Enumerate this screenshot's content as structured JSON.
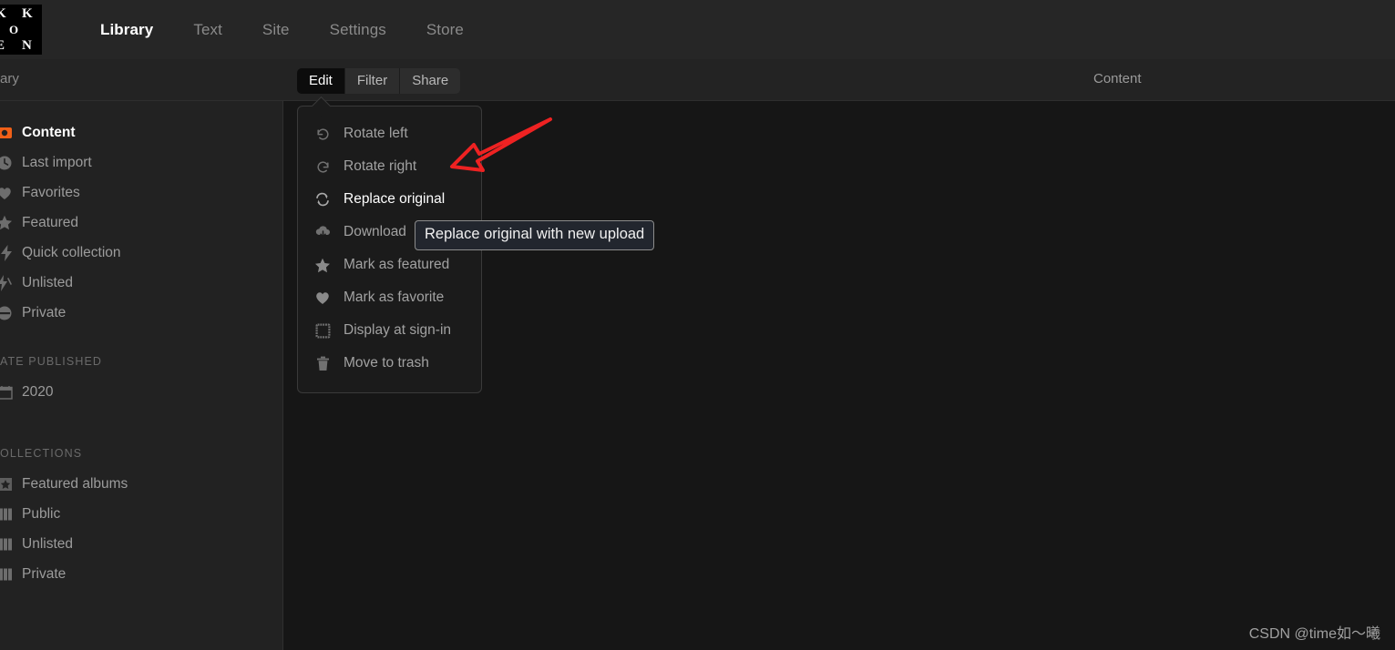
{
  "app": {
    "logo": {
      "letters": [
        "K",
        "K",
        "O",
        "E",
        "N"
      ],
      "name": "koken-logo"
    },
    "nav": [
      {
        "label": "Library",
        "active": true
      },
      {
        "label": "Text",
        "active": false
      },
      {
        "label": "Site",
        "active": false
      },
      {
        "label": "Settings",
        "active": false
      },
      {
        "label": "Store",
        "active": false
      }
    ]
  },
  "subheader": {
    "breadcrumb": "ary",
    "content_title": "Content"
  },
  "sidebar": {
    "items": [
      {
        "label": "Content",
        "icon": "content-icon",
        "active": true
      },
      {
        "label": "Last import",
        "icon": "clock-icon",
        "active": false
      },
      {
        "label": "Favorites",
        "icon": "heart-icon",
        "active": false
      },
      {
        "label": "Featured",
        "icon": "star-icon",
        "active": false
      },
      {
        "label": "Quick collection",
        "icon": "bolt-icon",
        "active": false
      },
      {
        "label": "Unlisted",
        "icon": "unlisted-icon",
        "active": false
      },
      {
        "label": "Private",
        "icon": "private-icon",
        "active": false
      }
    ],
    "date_published_header": "ATE PUBLISHED",
    "date_items": [
      {
        "label": "2020",
        "icon": "calendar-icon"
      }
    ],
    "collections_header": "OLLECTIONS",
    "collection_items": [
      {
        "label": "Featured albums",
        "icon": "featured-albums-icon"
      },
      {
        "label": "Public",
        "icon": "albums-icon"
      },
      {
        "label": "Unlisted",
        "icon": "albums-icon"
      },
      {
        "label": "Private",
        "icon": "albums-icon"
      }
    ]
  },
  "toolbar": {
    "buttons": [
      {
        "label": "Edit",
        "active": true
      },
      {
        "label": "Filter",
        "active": false
      },
      {
        "label": "Share",
        "active": false
      }
    ]
  },
  "edit_menu": {
    "items": [
      {
        "label": "Rotate left",
        "icon": "rotate-left-icon",
        "highlighted": false
      },
      {
        "label": "Rotate right",
        "icon": "rotate-right-icon",
        "highlighted": false
      },
      {
        "label": "Replace original",
        "icon": "replace-icon",
        "highlighted": true
      },
      {
        "label": "Download",
        "icon": "download-icon",
        "highlighted": false
      },
      {
        "label": "Mark as featured",
        "icon": "star-icon",
        "highlighted": false
      },
      {
        "label": "Mark as favorite",
        "icon": "heart-icon",
        "highlighted": false
      },
      {
        "label": "Display at sign-in",
        "icon": "frame-icon",
        "highlighted": false
      },
      {
        "label": "Move to trash",
        "icon": "trash-icon",
        "highlighted": false
      }
    ]
  },
  "tooltip": {
    "text": "Replace original with new upload"
  },
  "annotation": {
    "arrow_color": "#ee2222",
    "name": "red-arrow-annotation"
  },
  "watermark": {
    "text": "CSDN @time如～曦"
  },
  "colors": {
    "nav_bg": "#262626",
    "sidebar_bg": "#222222",
    "content_bg": "#161616",
    "menu_bg": "#1b1b1b",
    "accent_orange": "#f06018",
    "active_text": "#ffffff",
    "muted_text": "#9c9c9c"
  }
}
